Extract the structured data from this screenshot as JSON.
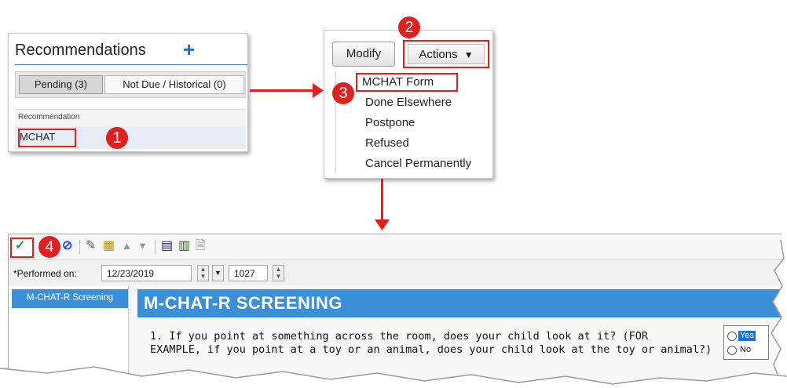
{
  "recommendations": {
    "title": "Recommendations",
    "plus_icon": "+",
    "tabs": [
      {
        "label": "Pending (3)",
        "selected": true
      },
      {
        "label": "Not Due / Historical (0)",
        "selected": false
      }
    ],
    "column_header": "Recommendation",
    "rows": [
      {
        "name": "MCHAT"
      }
    ]
  },
  "actions_panel": {
    "modify_label": "Modify",
    "actions_label": "Actions",
    "actions_caret": "▼",
    "menu_items": [
      "MCHAT Form",
      "Done Elsewhere",
      "Postpone",
      "Refused",
      "Cancel Permanently"
    ]
  },
  "form": {
    "performed_label": "*Performed on:",
    "date_value": "12/23/2019",
    "time_value": "1027",
    "side_nav_item": "M-CHAT-R Screening",
    "section_title": "M-CHAT-R SCREENING",
    "question_line1": "1. If you point at something across the room, does your child look at it? (FOR",
    "question_line2": "EXAMPLE, if you point at a toy or an animal, does your child look at the toy or animal?)",
    "answers": [
      "Yes",
      "No"
    ]
  },
  "steps": [
    "1",
    "2",
    "3",
    "4"
  ],
  "colors": {
    "highlight": "#e0201c",
    "accent_blue": "#3b8fd6",
    "badge": "#e02020"
  },
  "icons": [
    "plus-icon",
    "checkmark-icon",
    "cancel-icon",
    "edit-icon",
    "form-icon",
    "arrow-up-icon",
    "arrow-down-icon",
    "calculator-icon",
    "table-icon",
    "document-icon",
    "chevron-down-icon"
  ]
}
